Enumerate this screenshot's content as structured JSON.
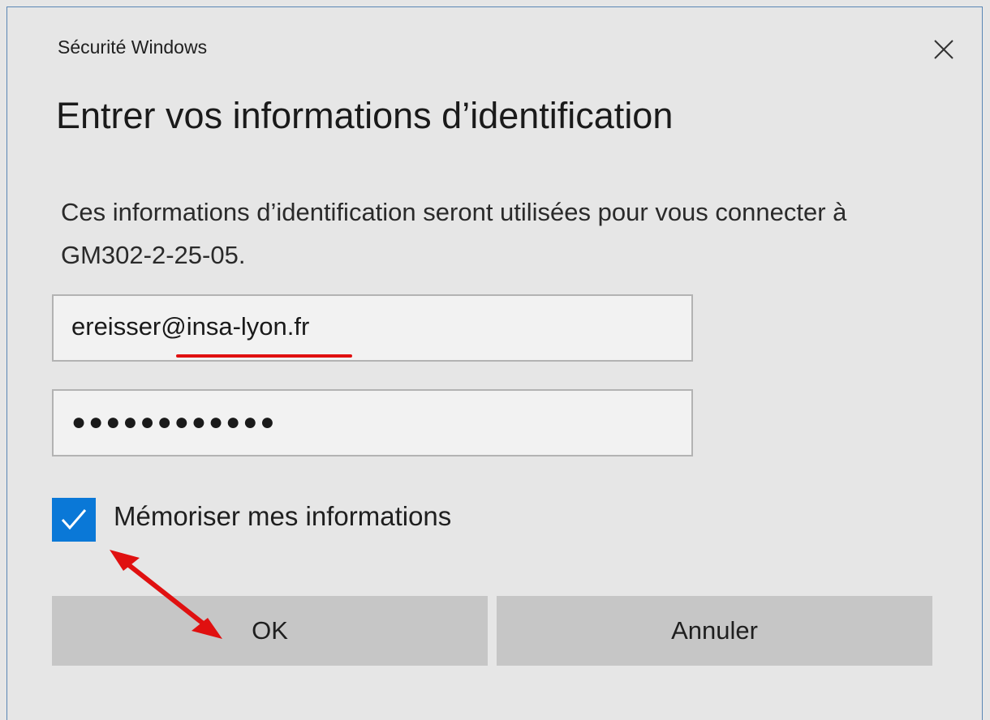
{
  "window": {
    "title": "Sécurité Windows",
    "close_icon": "close-icon"
  },
  "dialog": {
    "heading": "Entrer vos informations d’identification",
    "description": "Ces informations d’identification seront utilisées pour vous connecter à GM302-2-25-05."
  },
  "form": {
    "username_value": "ereisser@insa-lyon.fr",
    "password_masked": "●●●●●●●●●●●●",
    "remember": {
      "label": "Mémoriser mes informations",
      "checked": true
    }
  },
  "buttons": {
    "ok_label": "OK",
    "cancel_label": "Annuler"
  },
  "colors": {
    "accent": "#0a78d7",
    "annotation": "#e01010",
    "button_bg": "#c6c6c6",
    "dialog_bg": "#e6e6e6"
  }
}
